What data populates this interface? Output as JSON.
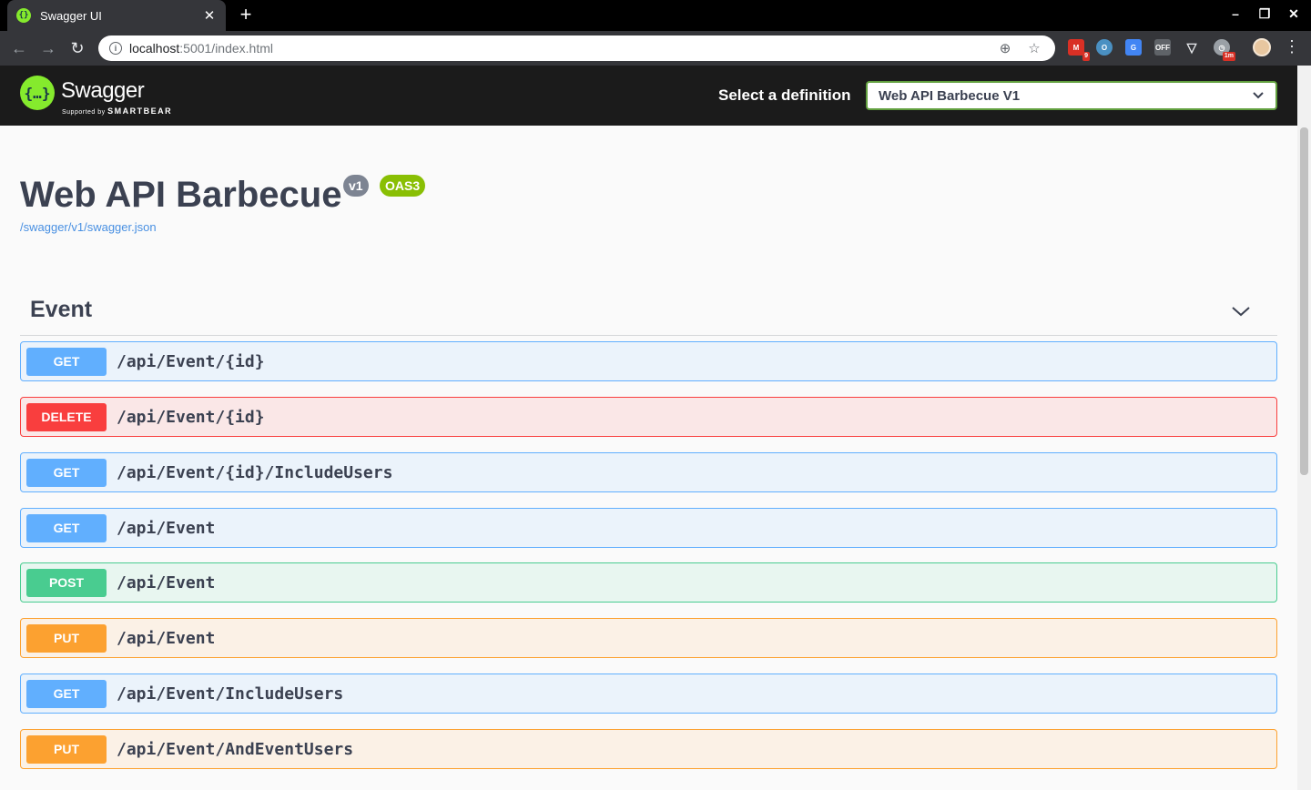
{
  "browser": {
    "tab_title": "Swagger UI",
    "url_host": "localhost",
    "url_rest": ":5001/index.html",
    "ext_badges": {
      "gmail": "9",
      "clock": "1m"
    }
  },
  "topbar": {
    "logo_text": "Swagger",
    "logo_sub_prefix": "Supported by",
    "logo_sub_brand": "SMARTBEAR",
    "definition_label": "Select a definition",
    "definition_value": "Web API Barbecue V1"
  },
  "info": {
    "title": "Web API Barbecue",
    "version_badge": "v1",
    "oas_badge": "OAS3",
    "spec_link": "/swagger/v1/swagger.json"
  },
  "section": {
    "title": "Event",
    "operations": [
      {
        "method": "GET",
        "path": "/api/Event/{id}"
      },
      {
        "method": "DELETE",
        "path": "/api/Event/{id}"
      },
      {
        "method": "GET",
        "path": "/api/Event/{id}/IncludeUsers"
      },
      {
        "method": "GET",
        "path": "/api/Event"
      },
      {
        "method": "POST",
        "path": "/api/Event"
      },
      {
        "method": "PUT",
        "path": "/api/Event"
      },
      {
        "method": "GET",
        "path": "/api/Event/IncludeUsers"
      },
      {
        "method": "PUT",
        "path": "/api/Event/AndEventUsers"
      }
    ]
  },
  "colors": {
    "get": "#61affe",
    "delete": "#f93e3e",
    "post": "#49cc90",
    "put": "#fca130",
    "swagger_green": "#85ea2d"
  }
}
